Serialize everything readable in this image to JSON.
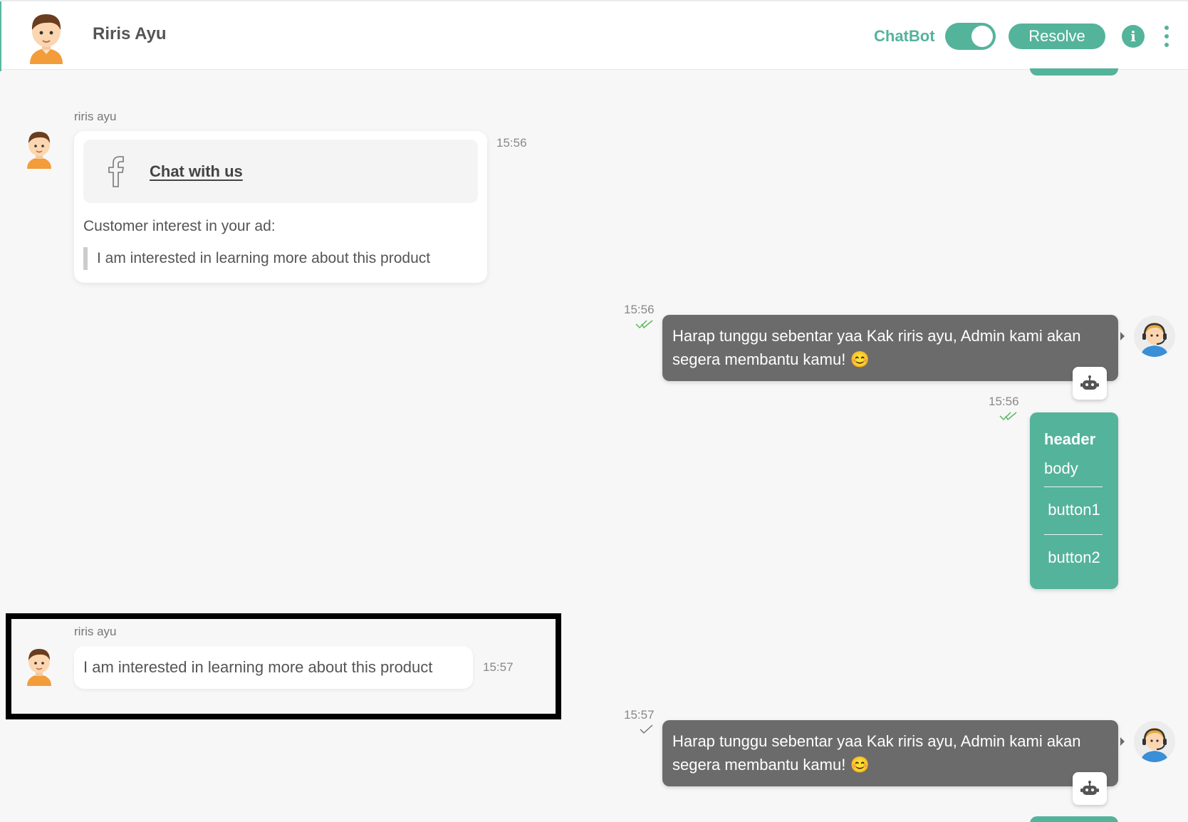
{
  "header": {
    "contact_name": "Riris Ayu",
    "chatbot_label": "ChatBot",
    "chatbot_enabled": true,
    "resolve_label": "Resolve",
    "info_label": "i"
  },
  "colors": {
    "accent": "#54b39b",
    "agent_bubble": "#6b6b6b",
    "highlight_border": "#000000"
  },
  "messages": {
    "m1": {
      "sender": "riris ayu",
      "time": "15:56",
      "card_link": "Chat with us",
      "card_icon": "facebook-icon",
      "interest_title": "Customer interest in your ad:",
      "interest_quote": "I am interested in learning more about this product"
    },
    "m2": {
      "time": "15:56",
      "text": "Harap tunggu sebentar yaa Kak riris ayu, Admin kami akan segera membantu kamu! 😊",
      "status": "read"
    },
    "m3": {
      "time": "15:56",
      "header": "header",
      "body": "body",
      "button1": "button1",
      "button2": "button2",
      "status": "read"
    },
    "m4": {
      "sender": "riris ayu",
      "time": "15:57",
      "text": "I am interested in learning more about this product"
    },
    "m5": {
      "time": "15:57",
      "text": "Harap tunggu sebentar yaa Kak riris ayu, Admin kami akan segera membantu kamu! 😊",
      "status": "sent"
    }
  }
}
